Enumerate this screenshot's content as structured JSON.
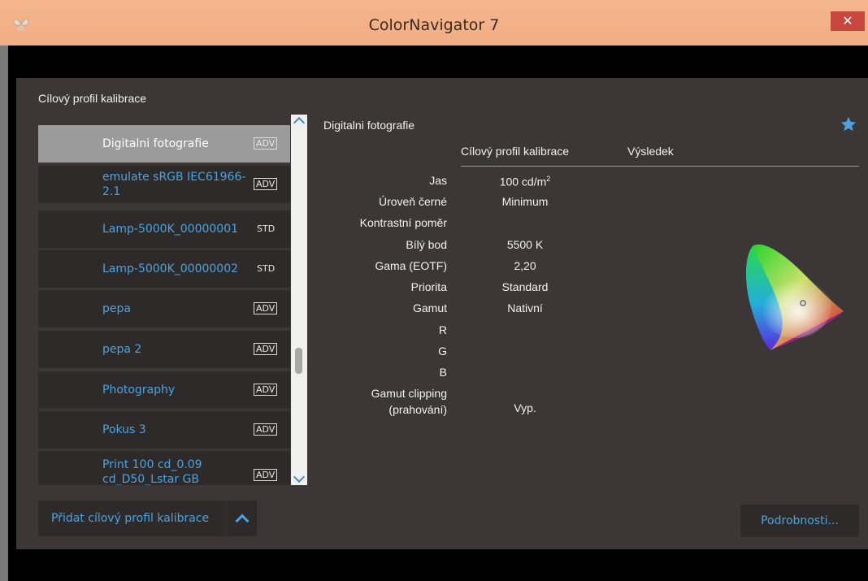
{
  "window": {
    "title": "ColorNavigator 7",
    "close_label": "✕"
  },
  "panel": {
    "section_title": "Cílový profil kalibrace",
    "items": [
      {
        "name": "Digitalni fotografie",
        "tag": "ADV",
        "selected": true
      },
      {
        "name": "emulate sRGB IEC61966-2.1",
        "tag": "ADV"
      },
      {
        "name": "Lamp-5000K_00000001",
        "tag": "STD"
      },
      {
        "name": "Lamp-5000K_00000002",
        "tag": "STD"
      },
      {
        "name": "pepa",
        "tag": "ADV"
      },
      {
        "name": "pepa 2",
        "tag": "ADV"
      },
      {
        "name": "Photography",
        "tag": "ADV"
      },
      {
        "name": "Pokus 3",
        "tag": "ADV"
      },
      {
        "name": "Print 100 cd_0.09 cd_D50_Lstar GB",
        "tag": "ADV"
      }
    ],
    "add_button_label": "Přidat cílový profil kalibrace"
  },
  "detail": {
    "title": "Digitalni fotografie",
    "col_target": "Cílový profil kalibrace",
    "col_result": "Výsledek",
    "rows": [
      {
        "label": "Jas",
        "value": "100 cd/m",
        "sup": "2"
      },
      {
        "label": "Úroveň černé",
        "value": "Minimum"
      },
      {
        "label": "Kontrastní poměr",
        "value": ""
      },
      {
        "label": "Bílý bod",
        "value": "5500 K"
      },
      {
        "label": "Gama (EOTF)",
        "value": "2,20"
      },
      {
        "label": "Priorita",
        "value": "Standard"
      },
      {
        "label": "Gamut",
        "value": "Nativní"
      },
      {
        "label": "R",
        "value": ""
      },
      {
        "label": "G",
        "value": ""
      },
      {
        "label": "B",
        "value": ""
      },
      {
        "label": "Gamut clipping",
        "label2": "(prahování)",
        "value": "Vyp."
      }
    ],
    "details_button_label": "Podrobnosti..."
  },
  "colors": {
    "accent": "#4aa3e0",
    "panel_bg": "#3c3636",
    "item_bg": "#2e2a2a",
    "selected_bg": "#9b9b9b",
    "titlebar": "#f2ad82",
    "close": "#c7463d"
  },
  "icons": {
    "app": "butterfly-icon",
    "favorite": "star-icon",
    "gamut": "chromaticity-diagram-icon"
  }
}
